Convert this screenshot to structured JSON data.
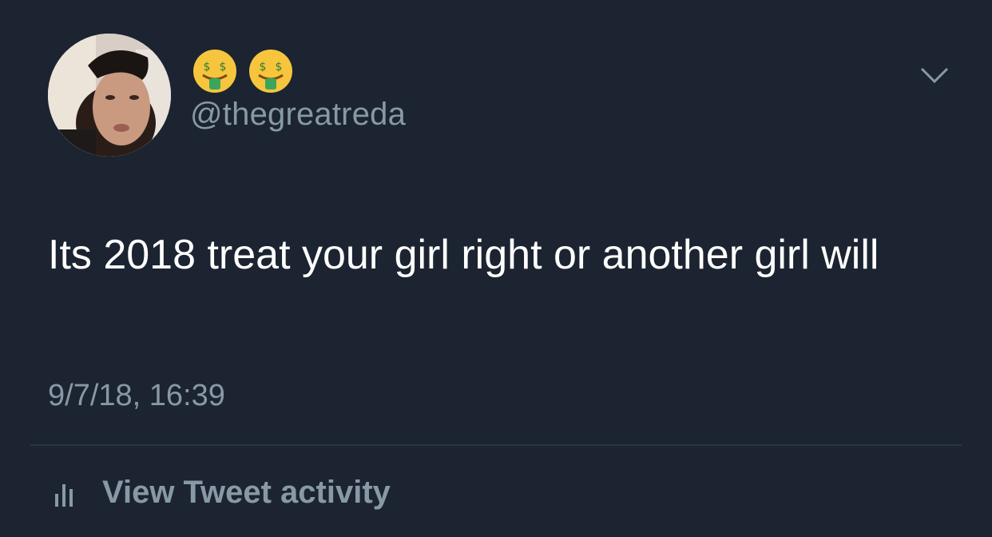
{
  "tweet": {
    "display_name_icons": [
      "money-mouth-face-icon",
      "money-mouth-face-icon"
    ],
    "handle": "@thegreatreda",
    "text": "Its 2018 treat your girl right or another girl will",
    "timestamp": "9/7/18, 16:39"
  },
  "actions": {
    "activity_label": "View Tweet activity",
    "activity_icon": "bar-chart-icon",
    "menu_icon": "chevron-down-icon"
  },
  "colors": {
    "background": "#1b2430",
    "text": "#ffffff",
    "secondary_text": "#8899a6",
    "divider": "#2b3540"
  }
}
